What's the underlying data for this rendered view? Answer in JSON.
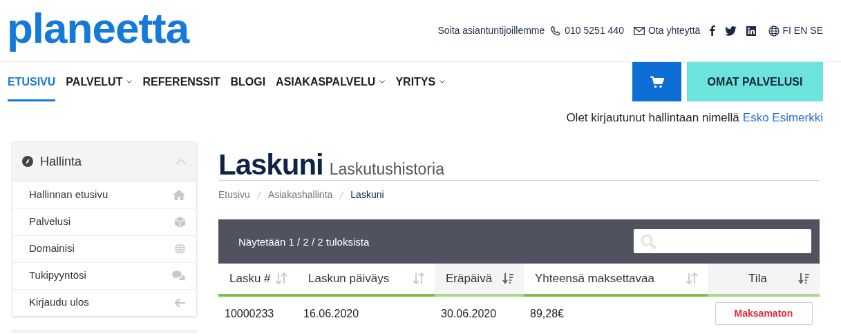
{
  "logo": {
    "text": "planeetta"
  },
  "topbar": {
    "call_label": "Soita asiantuntijoillemme",
    "phone": "010 5251 440",
    "contact": "Ota yhteyttä",
    "languages": [
      "FI",
      "EN",
      "SE"
    ]
  },
  "nav": [
    {
      "label": "ETUSIVU",
      "selected": true,
      "has_menu": false
    },
    {
      "label": "PALVELUT",
      "selected": false,
      "has_menu": true
    },
    {
      "label": "REFERENSSIT",
      "selected": false,
      "has_menu": false
    },
    {
      "label": "BLOGI",
      "selected": false,
      "has_menu": false
    },
    {
      "label": "ASIAKASPALVELU",
      "selected": false,
      "has_menu": true
    },
    {
      "label": "YRITYS",
      "selected": false,
      "has_menu": true
    }
  ],
  "my_services_button": "OMAT PALVELUSI",
  "login_notice": {
    "text": "Olet kirjautunut hallintaan nimellä",
    "user": "Esko Esimerkki"
  },
  "sidebar": {
    "title": "Hallinta",
    "expanded": true,
    "items": [
      {
        "label": "Hallinnan etusivu"
      },
      {
        "label": "Palvelusi"
      },
      {
        "label": "Domainisi"
      },
      {
        "label": "Tukipyyntösi"
      },
      {
        "label": "Kirjaudu ulos"
      }
    ]
  },
  "page": {
    "title": "Laskuni",
    "subtitle": "Laskutushistoria"
  },
  "breadcrumb": [
    {
      "label": "Etusivu",
      "current": false
    },
    {
      "label": "Asiakashallinta",
      "current": false
    },
    {
      "label": "Laskuni",
      "current": true
    }
  ],
  "table": {
    "summary": "Näytetään 1 / 2 / 2 tuloksista",
    "columns": [
      {
        "label": "Lasku #",
        "sorted": false
      },
      {
        "label": "Laskun päiväys",
        "sorted": false
      },
      {
        "label": "Eräpäivä",
        "sorted": true
      },
      {
        "label": "Yhteensä maksettavaa",
        "sorted": false
      },
      {
        "label": "Tila",
        "sorted": true
      }
    ],
    "rows": [
      {
        "cells": [
          "10000233",
          "16.06.2020",
          "30.06.2020",
          "89,28€"
        ],
        "status": "Maksamaton"
      }
    ]
  }
}
